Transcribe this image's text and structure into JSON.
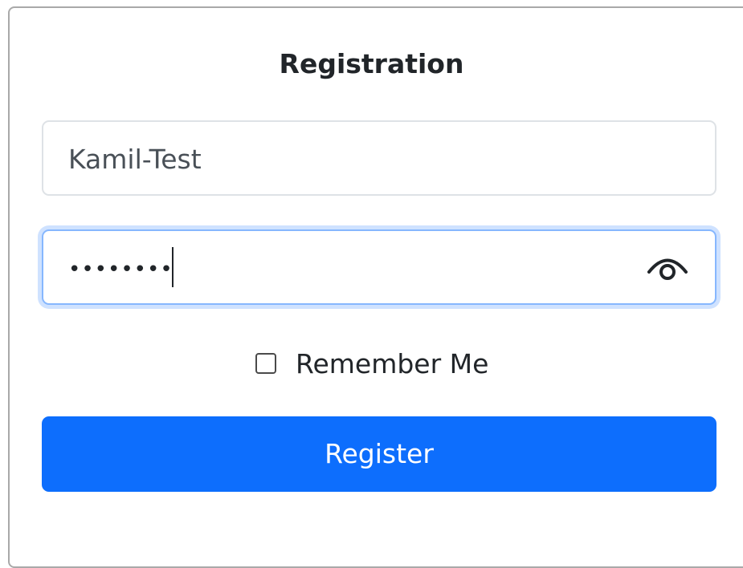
{
  "form": {
    "title": "Registration",
    "username": {
      "value": "Kamil-Test"
    },
    "password": {
      "masked_value": "••••••••",
      "toggle_icon": "eye-icon"
    },
    "remember": {
      "label": "Remember Me",
      "checked": false
    },
    "submit_label": "Register"
  },
  "colors": {
    "primary": "#0d6efd",
    "focus_border": "#86b7fe",
    "focus_ring": "#cfe2ff",
    "text": "#212529"
  }
}
